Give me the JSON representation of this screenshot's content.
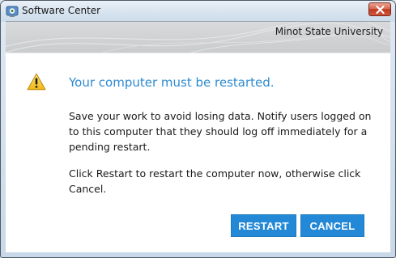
{
  "window": {
    "title": "Software Center",
    "close_label": "Close"
  },
  "banner": {
    "organization": "Minot State University"
  },
  "dialog": {
    "heading": "Your computer must be restarted.",
    "message_1": "Save your work to avoid losing data. Notify users logged on to this computer that they should log off immediately for a pending restart.",
    "message_2": "Click Restart to restart the computer now, otherwise click Cancel.",
    "icon": "warning-icon"
  },
  "buttons": {
    "restart_label": "RESTART",
    "cancel_label": "CANCEL"
  },
  "colors": {
    "accent": "#2389d6",
    "heading": "#2e8bd0",
    "close_button": "#c03b22"
  }
}
